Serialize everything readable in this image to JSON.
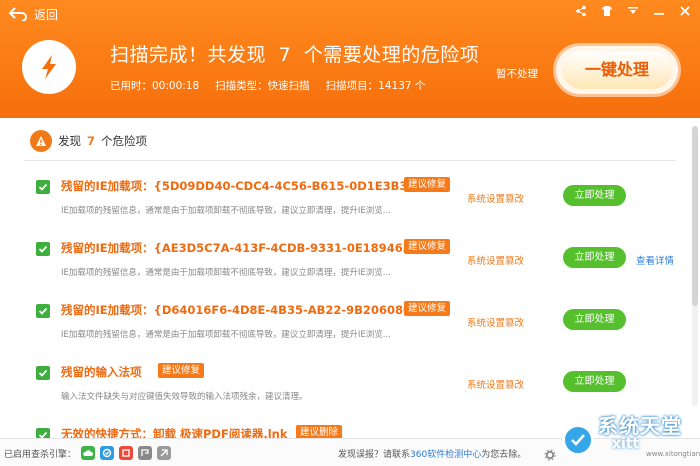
{
  "header": {
    "back_label": "返回",
    "title_prefix": "扫描完成！共发现",
    "title_count": "7",
    "title_suffix": "个需要处理的危险项",
    "time_used": "已用时：00:00:18",
    "scan_type": "扫描类型：快速扫描",
    "scan_items": "扫描项目：14137 个",
    "ignore_label": "暂不处理",
    "fix_all_label": "一键处理"
  },
  "summary": {
    "prefix": "发现",
    "count": "7",
    "suffix": "个危险项"
  },
  "items": [
    {
      "name": "残留的IE加载项：{5D09DD40-CDC4-4C56-B615-0D1E3B35...",
      "tag": "建议修复",
      "desc": "IE加载项的残留信息，通常是由于加载项卸载不彻底导致，建议立即清理，提升IE浏览...",
      "category": "系统设置篡改",
      "action": "立即处理",
      "detail": ""
    },
    {
      "name": "残留的IE加载项：{AE3D5C7A-413F-4CDB-9331-0E1894637...",
      "tag": "建议修复",
      "desc": "IE加载项的残留信息，通常是由于加载项卸载不彻底导致，建议立即清理，提升IE浏览...",
      "category": "系统设置篡改",
      "action": "立即处理",
      "detail": "查看详情"
    },
    {
      "name": "残留的IE加载项：{D64016F6-4D8E-4B35-AB22-9B2060800...",
      "tag": "建议修复",
      "desc": "IE加载项的残留信息，通常是由于加载项卸载不彻底导致，建议立即清理，提升IE浏览...",
      "category": "系统设置篡改",
      "action": "立即处理",
      "detail": ""
    },
    {
      "name": "残留的输入法项",
      "tag": "建议修复",
      "desc": "输入法文件缺失与对应键值失效导致的输入法项残余，建议清理。",
      "category": "系统设置篡改",
      "action": "立即处理",
      "detail": ""
    },
    {
      "name": "无效的快捷方式：卸载 极速PDF阅读器.lnk",
      "tag": "建议删除",
      "desc": "",
      "category": "",
      "action": "",
      "detail": ""
    }
  ],
  "footer": {
    "engines_label": "已启用查杀引擎：",
    "report_prefix": "发现误报？请联系",
    "report_link": "360软件检测中心",
    "report_suffix": "为您去除。"
  },
  "watermark": {
    "text": "系统天堂",
    "sub": "xitt",
    "url": "www.xitongtiantang.com"
  },
  "colors": {
    "header": "#f66f0c",
    "accent_orange": "#f07a17",
    "action_green": "#56bf2e",
    "link_blue": "#2b7bd6"
  }
}
